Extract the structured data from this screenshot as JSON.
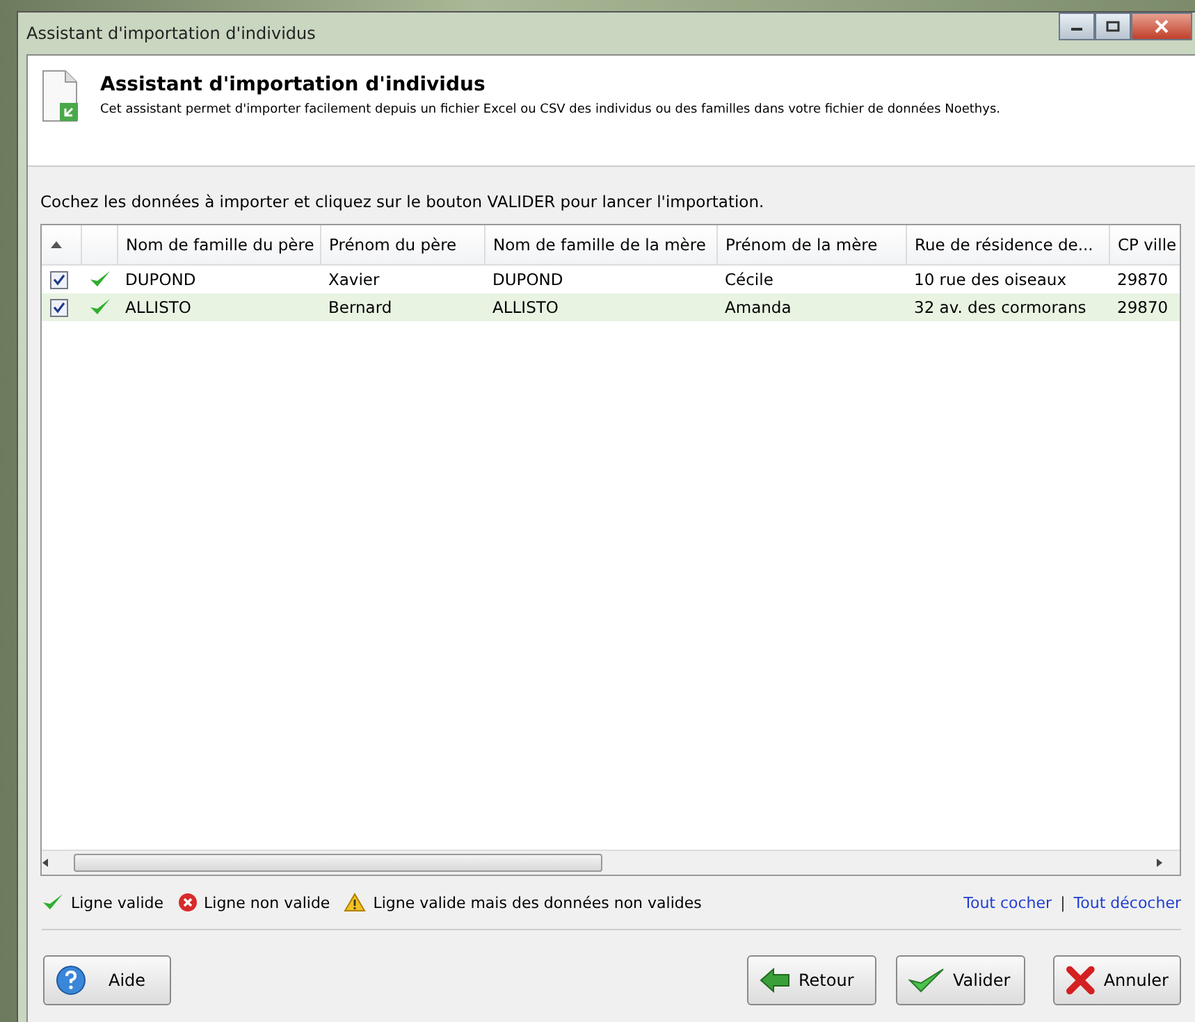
{
  "window": {
    "title": "Assistant d'importation d'individus"
  },
  "header": {
    "title": "Assistant d'importation d'individus",
    "description": "Cet assistant permet d'importer facilement depuis un fichier Excel ou CSV des individus ou des familles dans votre fichier de données Noethys."
  },
  "instruction": "Cochez les données à importer et cliquez sur le bouton VALIDER pour lancer l'importation.",
  "table": {
    "columns": [
      "Nom de famille du père",
      "Prénom du père",
      "Nom de famille de la mère",
      "Prénom de la mère",
      "Rue de résidence de...",
      "CP ville"
    ],
    "rows": [
      {
        "checked": true,
        "valid": true,
        "selected": false,
        "cells": [
          "DUPOND",
          "Xavier",
          "DUPOND",
          "Cécile",
          "10 rue des oiseaux",
          "29870"
        ]
      },
      {
        "checked": true,
        "valid": true,
        "selected": true,
        "cells": [
          "ALLISTO",
          "Bernard",
          "ALLISTO",
          "Amanda",
          "32 av. des cormorans",
          "29870"
        ]
      }
    ]
  },
  "legend": [
    {
      "kind": "valid",
      "label": "Ligne valide"
    },
    {
      "kind": "invalid",
      "label": "Ligne non valide"
    },
    {
      "kind": "warning",
      "label": "Ligne valide mais des données non valides"
    }
  ],
  "links": [
    "Tout cocher",
    "|",
    "Tout décocher"
  ],
  "buttons": [
    {
      "kind": "help",
      "label": "Aide"
    },
    {
      "kind": "back",
      "label": "Retour"
    },
    {
      "kind": "ok",
      "label": "Valider"
    },
    {
      "kind": "cancel",
      "label": "Annuler"
    }
  ]
}
